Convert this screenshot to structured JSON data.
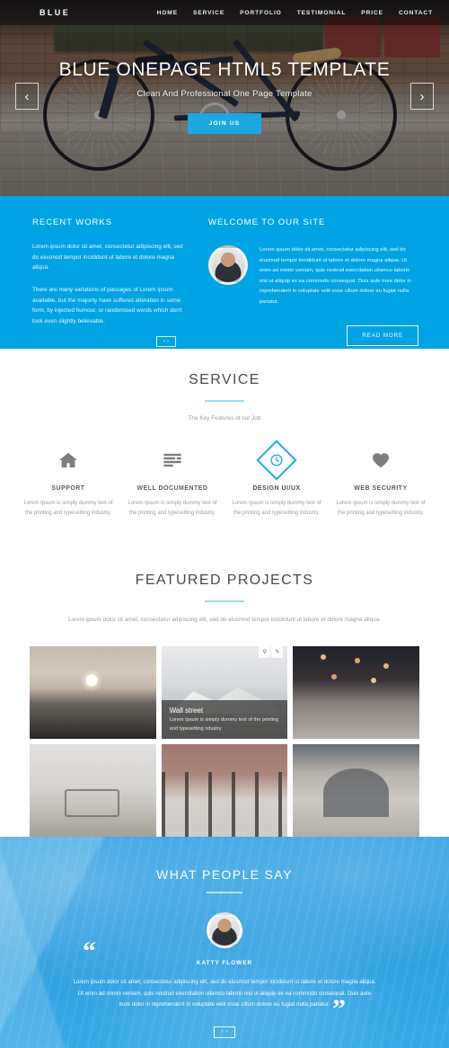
{
  "nav": {
    "logo": "BLUE",
    "items": [
      {
        "label": "HOME"
      },
      {
        "label": "SERVICE"
      },
      {
        "label": "PORTFOLIO"
      },
      {
        "label": "TESTIMONIAL"
      },
      {
        "label": "PRICE"
      },
      {
        "label": "CONTACT"
      }
    ]
  },
  "hero": {
    "title": "BLUE ONEPAGE HTML5 TEMPLATE",
    "subtitle": "Clean And Professional One Page Template",
    "cta": "JOIN US",
    "prev_icon": "‹",
    "next_icon": "›"
  },
  "intro": {
    "recent_works": {
      "heading": "RECENT WORKS",
      "paragraph1": "Lorem ipsum dolor sit amet, consectetur adipiscing elit, sed do eiusmod tempor incididunt ut labore et dolore magna aliqua.",
      "paragraph2": "There are many variations of passages of Lorem Ipsum available, but the majority have suffered alteration in some form, by injected humour, or randomised words which don't look even slightly believable.",
      "prev_icon": "‹",
      "next_icon": "›"
    },
    "welcome": {
      "heading": "WELCOME TO OUR SITE",
      "paragraph": "Lorem ipsum dolor sit amet, consectetur adipiscing elit, sed do eiusmod tempor incididunt ut labore et dolore magna aliqua. Ut enim ad minim veniam, quis nostrud exercitation ullamco laboris nisi ut aliquip ex ea commodo consequat. Duis aute irure dolor in reprehenderit in voluptate velit esse cillum dolore eu fugiat nulla pariatur.",
      "button": "READ MORE"
    },
    "accent_color": "#00a3e4"
  },
  "service": {
    "title": "SERVICE",
    "subtitle": "The Key Features of our Job",
    "items": [
      {
        "icon": "home-icon",
        "name": "SUPPORT",
        "text": "Lorem Ipsum is simply dummy text of the printing and typesetting industry.",
        "active": false
      },
      {
        "icon": "list-lines-icon",
        "name": "WELL DOCUMENTED",
        "text": "Lorem Ipsum is simply dummy text of the printing and typesetting industry.",
        "active": false
      },
      {
        "icon": "clock-icon",
        "name": "DESIGN UI/UX",
        "text": "Lorem Ipsum is simply dummy text of the printing and typesetting industry.",
        "active": true
      },
      {
        "icon": "heart-icon",
        "name": "WEB SECURITY",
        "text": "Lorem Ipsum is simply dummy text of the printing and typesetting industry.",
        "active": false
      }
    ],
    "highlight_color": "#2ba8e8"
  },
  "portfolio": {
    "title": "FEATURED PROJECTS",
    "subtitle": "Lorem ipsum dolor sit amet, consectetur adipiscing elit, sed do eiusmod tempor incididunt ut labore et dolore magna aliqua.",
    "tiles": [
      {
        "alt": "sunset-over-sea",
        "caption_title": "",
        "caption_text": "",
        "hovered": false
      },
      {
        "alt": "snowy-mountain",
        "caption_title": "Wall street",
        "caption_text": "Lorem Ipsum is simply dummy text of the printing and typesetting ndustry.",
        "hovered": true
      },
      {
        "alt": "evening-city-street",
        "caption_title": "",
        "caption_text": "",
        "hovered": false
      },
      {
        "alt": "park-bench-in-fog",
        "caption_title": "",
        "caption_text": "",
        "hovered": false
      },
      {
        "alt": "autumn-trees",
        "caption_title": "",
        "caption_text": "",
        "hovered": false
      },
      {
        "alt": "rock-arch",
        "caption_title": "",
        "caption_text": "",
        "hovered": false
      }
    ],
    "actions": {
      "zoom_icon": "⚲",
      "link_icon": "✎"
    }
  },
  "testimonial": {
    "title": "WHAT PEOPLE SAY",
    "author": "KATTY FLOWER",
    "quote": "Lorem ipsum dolor sit amet, consectetur adipiscing elit, sed do eiusmod tempor incididunt ut labore et dolore magna aliqua. Ut enim ad minim veniam, quis nostrud exercitation ullamco laboris nisi ut aliquip ex ea commodo consequat. Duis aute irure dolor in reprehenderit in voluptate velit esse cillum dolore eu fugiat nulla pariatur.",
    "quote_open": "“",
    "quote_close": "”",
    "prev_icon": "‹",
    "next_icon": "›",
    "background_color": "#2f9fe0"
  }
}
